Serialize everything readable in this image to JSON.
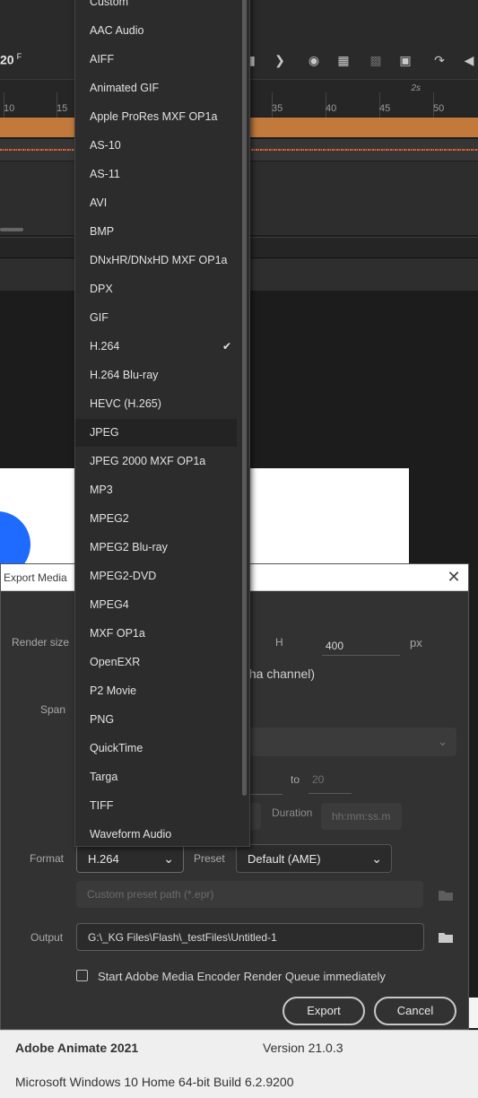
{
  "timeline": {
    "frame_number": "20",
    "frame_unit": "F",
    "ruler_ticks": [
      "10",
      "15",
      "35",
      "40",
      "45",
      "50"
    ],
    "seconds_marker": "2s",
    "track_colors": {
      "audio_layer": "#c17a3c",
      "waveform": "#e0673b"
    }
  },
  "dialog": {
    "title": "Export Media",
    "render_size_label": "Render size",
    "height_label": "H",
    "height_value": "400",
    "unit_label": "px",
    "alpha_text": "lpha channel)",
    "span_label": "Span",
    "to_label": "to",
    "to_value": "20",
    "duration_label": "Duration",
    "duration_placeholder": "hh:mm:ss.m",
    "format_label": "Format",
    "format_value": "H.264",
    "preset_label": "Preset",
    "preset_value": "Default (AME)",
    "custom_preset_placeholder": "Custom preset path (*.epr)",
    "output_label": "Output",
    "output_value": "G:\\_KG Files\\Flash\\_testFiles\\Untitled-1",
    "queue_checkbox_label": "Start Adobe Media Encoder Render Queue immediately",
    "queue_checked": false,
    "export_button": "Export",
    "cancel_button": "Cancel"
  },
  "format_dropdown": {
    "items": [
      "Custom",
      "AAC Audio",
      "AIFF",
      "Animated GIF",
      "Apple ProRes MXF OP1a",
      "AS-10",
      "AS-11",
      "AVI",
      "BMP",
      "DNxHR/DNxHD MXF OP1a",
      "DPX",
      "GIF",
      "H.264",
      "H.264 Blu-ray",
      "HEVC (H.265)",
      "JPEG",
      "JPEG 2000 MXF OP1a",
      "MP3",
      "MPEG2",
      "MPEG2 Blu-ray",
      "MPEG2-DVD",
      "MPEG4",
      "MXF OP1a",
      "OpenEXR",
      "P2 Movie",
      "PNG",
      "QuickTime",
      "Targa",
      "TIFF",
      "Waveform Audio"
    ],
    "selected": "H.264",
    "hovered": "JPEG"
  },
  "footer": {
    "app_name": "Adobe Animate 2021",
    "version": "Version 21.0.3",
    "os": "Microsoft Windows 10 Home 64-bit Build 6.2.9200"
  }
}
